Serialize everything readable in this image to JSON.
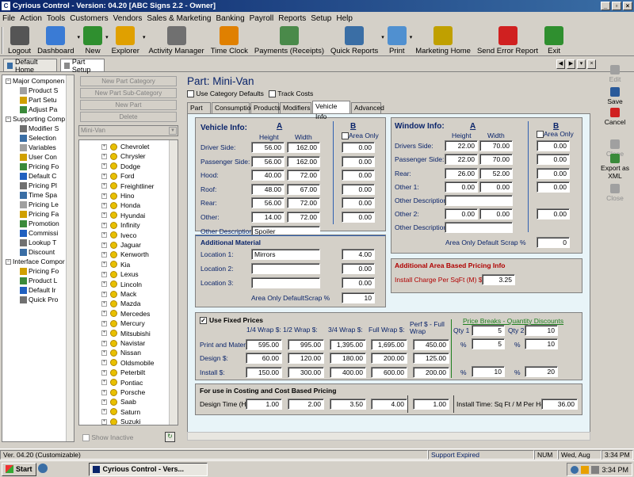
{
  "title": "Cyrious Control - Version: 04.20 [ABC Signs 2.2 - Owner]",
  "menu": [
    "File",
    "Action",
    "Tools",
    "Customers",
    "Vendors",
    "Sales & Marketing",
    "Banking",
    "Payroll",
    "Reports",
    "Setup",
    "Help"
  ],
  "toolbar": [
    "Logout",
    "Dashboard",
    "New",
    "Explorer",
    "Activity Manager",
    "Time Clock",
    "Payments (Receipts)",
    "Quick Reports",
    "Print",
    "Marketing Home",
    "Send Error Report",
    "Exit"
  ],
  "doc_tabs": [
    "Default Home",
    "Part Setup"
  ],
  "tree": [
    {
      "t": "Major Componen",
      "lv": 0,
      "pm": "-"
    },
    {
      "t": "Product S",
      "lv": 1
    },
    {
      "t": "Part Setu",
      "lv": 1
    },
    {
      "t": "Adjust Pa",
      "lv": 1
    },
    {
      "t": "Supporting Comp",
      "lv": 0,
      "pm": "-"
    },
    {
      "t": "Modifier S",
      "lv": 1
    },
    {
      "t": "Selection",
      "lv": 1
    },
    {
      "t": "Variables",
      "lv": 1
    },
    {
      "t": "User Con",
      "lv": 1
    },
    {
      "t": "Pricing Fo",
      "lv": 1
    },
    {
      "t": "Default C",
      "lv": 1
    },
    {
      "t": "Pricing Pl",
      "lv": 1
    },
    {
      "t": "Time Spa",
      "lv": 1
    },
    {
      "t": "Pricing Le",
      "lv": 1
    },
    {
      "t": "Pricing Fa",
      "lv": 1
    },
    {
      "t": "Promotion",
      "lv": 1
    },
    {
      "t": "Commissi",
      "lv": 1
    },
    {
      "t": "Lookup T",
      "lv": 1
    },
    {
      "t": "Discount",
      "lv": 1
    },
    {
      "t": "Interface Compor",
      "lv": 0,
      "pm": "-"
    },
    {
      "t": "Pricing Fo",
      "lv": 1
    },
    {
      "t": "Product L",
      "lv": 1
    },
    {
      "t": "Default Ir",
      "lv": 1
    },
    {
      "t": "Quick Pro",
      "lv": 1
    }
  ],
  "mid_buttons": [
    "New Part Category",
    "New Part Sub-Category",
    "New Part",
    "Delete"
  ],
  "category_select": "Mini-Van",
  "makes": [
    "Chevrolet",
    "Chrysler",
    "Dodge",
    "Ford",
    "Freightliner",
    "Hino",
    "Honda",
    "Hyundai",
    "Infinity",
    "Iveco",
    "Jaguar",
    "Kenworth",
    "Kia",
    "Lexus",
    "Lincoln",
    "Mack",
    "Mazda",
    "Mercedes",
    "Mercury",
    "Mitsubishi",
    "Navistar",
    "Nissan",
    "Oldsmobile",
    "Peterbilt",
    "Pontiac",
    "Porsche",
    "Saab",
    "Saturn",
    "Suzuki"
  ],
  "show_inactive": "Show Inactive",
  "part": {
    "label": "Part:",
    "name": "Mini-Van",
    "use_cat": "Use Category Defaults",
    "track": "Track Costs"
  },
  "part_tabs": [
    "Part",
    "Consumption",
    "Products",
    "Modifiers",
    "Vehicle Info",
    "Advanced"
  ],
  "vehicle": {
    "title": "Vehicle Info:",
    "A": "A",
    "B": "B",
    "height": "Height",
    "width": "Width",
    "area_only": "Area Only",
    "rows": [
      {
        "l": "Driver Side:",
        "h": "56.00",
        "w": "162.00",
        "b": "0.00"
      },
      {
        "l": "Passenger Side:",
        "h": "56.00",
        "w": "162.00",
        "b": "0.00"
      },
      {
        "l": "Hood:",
        "h": "40.00",
        "w": "72.00",
        "b": "0.00"
      },
      {
        "l": "Roof:",
        "h": "48.00",
        "w": "67.00",
        "b": "0.00"
      },
      {
        "l": "Rear:",
        "h": "56.00",
        "w": "72.00",
        "b": "0.00"
      },
      {
        "l": "Other:",
        "h": "14.00",
        "w": "72.00",
        "b": "0.00"
      }
    ],
    "other_desc_l": "Other Description:",
    "other_desc": "Spoiler"
  },
  "window": {
    "title": "Window Info:",
    "A": "A",
    "B": "B",
    "height": "Height",
    "width": "Width",
    "area_only": "Area Only",
    "rows": [
      {
        "l": "Drivers Side:",
        "h": "22.00",
        "w": "70.00",
        "b": "0.00"
      },
      {
        "l": "Passenger Side:",
        "h": "22.00",
        "w": "70.00",
        "b": "0.00"
      },
      {
        "l": "Rear:",
        "h": "26.00",
        "w": "52.00",
        "b": "0.00"
      },
      {
        "l": "Other 1:",
        "h": "0.00",
        "w": "0.00",
        "b": "0.00"
      }
    ],
    "od1": "Other Description:",
    "o2": {
      "l": "Other 2:",
      "h": "0.00",
      "w": "0.00",
      "b": "0.00"
    },
    "od2": "Other Description:",
    "scrap_l": "Area Only Default Scrap %",
    "scrap": "0"
  },
  "material": {
    "title": "Additional Material",
    "rows": [
      {
        "l": "Location 1:",
        "d": "Mirrors",
        "v": "4.00"
      },
      {
        "l": "Location 2:",
        "d": "",
        "v": "0.00"
      },
      {
        "l": "Location 3:",
        "d": "",
        "v": "0.00"
      }
    ],
    "scrap_l": "Area Only DefaultScrap %",
    "scrap": "10"
  },
  "areapricing": {
    "title": "Additional Area Based Pricing Info",
    "l": "Install Charge Per SqFt (M) $:",
    "v": "3.25"
  },
  "fixed": {
    "title": "Use Fixed Prices",
    "cols": [
      "1/4 Wrap $:",
      "1/2 Wrap $:",
      "3/4 Wrap $:",
      "Full Wrap $:",
      "Perf $ - Full Wrap"
    ],
    "rows": [
      {
        "l": "Print and Material $:",
        "v": [
          "595.00",
          "995.00",
          "1,395.00",
          "1,695.00",
          "450.00"
        ]
      },
      {
        "l": "Design $:",
        "v": [
          "60.00",
          "120.00",
          "180.00",
          "200.00",
          "125.00"
        ]
      },
      {
        "l": "Install $:",
        "v": [
          "150.00",
          "300.00",
          "400.00",
          "600.00",
          "200.00"
        ]
      }
    ],
    "breaks": "Price Breaks - Quantity Discounts",
    "qty1": "Qty 1",
    "qty2": "Qty 2",
    "q1": "5",
    "q2": "10",
    "p1a": "5",
    "p2a": "10",
    "p1b": "10",
    "p2b": "20",
    "pct": "%"
  },
  "costing": {
    "title": "For use in Costing and Cost Based Pricing",
    "l": "Design Time (Hrs):",
    "v": [
      "1.00",
      "2.00",
      "3.50",
      "4.00",
      "1.00"
    ],
    "inst_l": "Install Time: Sq Ft / M Per Hour:",
    "inst": "36.00"
  },
  "right": [
    "Edit",
    "Save",
    "Cancel",
    "Clone",
    "Export as XML",
    "Close"
  ],
  "status": {
    "version": "Ver. 04.20 (Customizable)",
    "support": "Support Expired",
    "num": "NUM",
    "date": "Wed, Aug 20",
    "time": "3:34 PM"
  },
  "taskbar": {
    "start": "Start",
    "app": "Cyrious Control - Vers..."
  }
}
